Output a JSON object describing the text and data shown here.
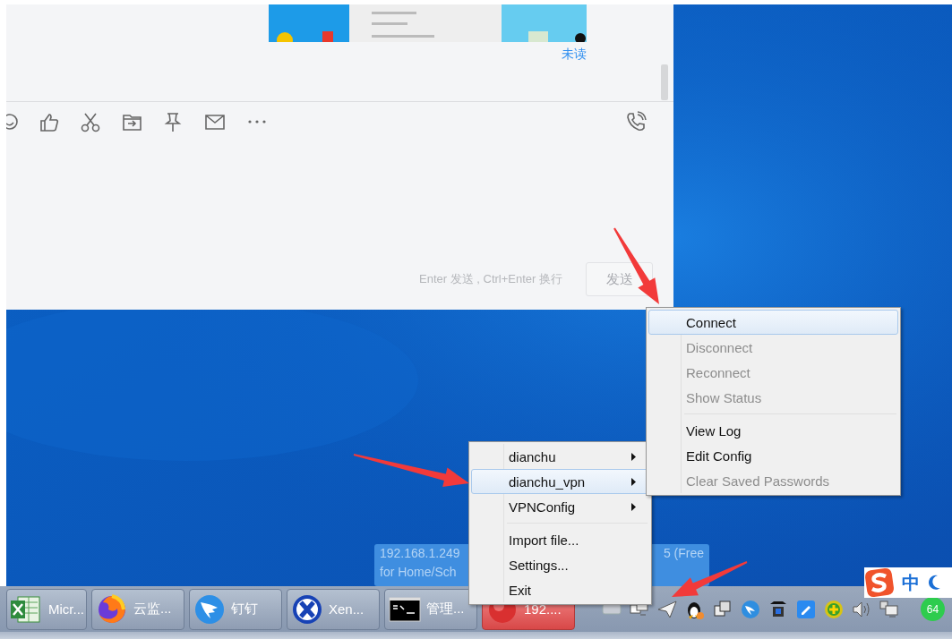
{
  "chat": {
    "unread_label": "未读",
    "hint": "Enter 发送 , Ctrl+Enter 换行",
    "send_button": {
      "label": "发送",
      "disabled": true
    }
  },
  "tooltip": {
    "texts": [
      "192.168.1.249",
      "5 (Free",
      "for Home/Sch"
    ]
  },
  "tray_menu": {
    "items": [
      {
        "kind": "submenu",
        "label": "dianchu",
        "selected": false
      },
      {
        "kind": "submenu",
        "label": "dianchu_vpn",
        "selected": true
      },
      {
        "kind": "submenu",
        "label": "VPNConfig",
        "selected": false
      },
      {
        "kind": "separator"
      },
      {
        "kind": "command",
        "label": "Import file...",
        "selected": false
      },
      {
        "kind": "command",
        "label": "Settings...",
        "selected": false
      },
      {
        "kind": "command",
        "label": "Exit",
        "selected": false
      }
    ]
  },
  "submenu": {
    "items": [
      {
        "kind": "command",
        "label": "Connect",
        "selected": true,
        "disabled": false
      },
      {
        "kind": "command",
        "label": "Disconnect",
        "selected": false,
        "disabled": true
      },
      {
        "kind": "command",
        "label": "Reconnect",
        "selected": false,
        "disabled": true
      },
      {
        "kind": "command",
        "label": "Show Status",
        "selected": false,
        "disabled": true
      },
      {
        "kind": "separator"
      },
      {
        "kind": "command",
        "label": "View Log",
        "selected": false,
        "disabled": false
      },
      {
        "kind": "command",
        "label": "Edit Config",
        "selected": false,
        "disabled": false
      },
      {
        "kind": "command",
        "label": "Clear Saved Passwords",
        "selected": false,
        "disabled": true
      }
    ]
  },
  "taskbar": {
    "buttons": [
      {
        "label": "Micr...",
        "highlighted": false
      },
      {
        "label": "云监...",
        "highlighted": false
      },
      {
        "label": "钉钉",
        "highlighted": false
      },
      {
        "label": "Xen...",
        "highlighted": false
      },
      {
        "label": "管理...",
        "highlighted": false
      },
      {
        "label": "192....",
        "highlighted": true
      }
    ]
  },
  "ime": {
    "label": "中"
  },
  "tray": {
    "badge": "64"
  }
}
